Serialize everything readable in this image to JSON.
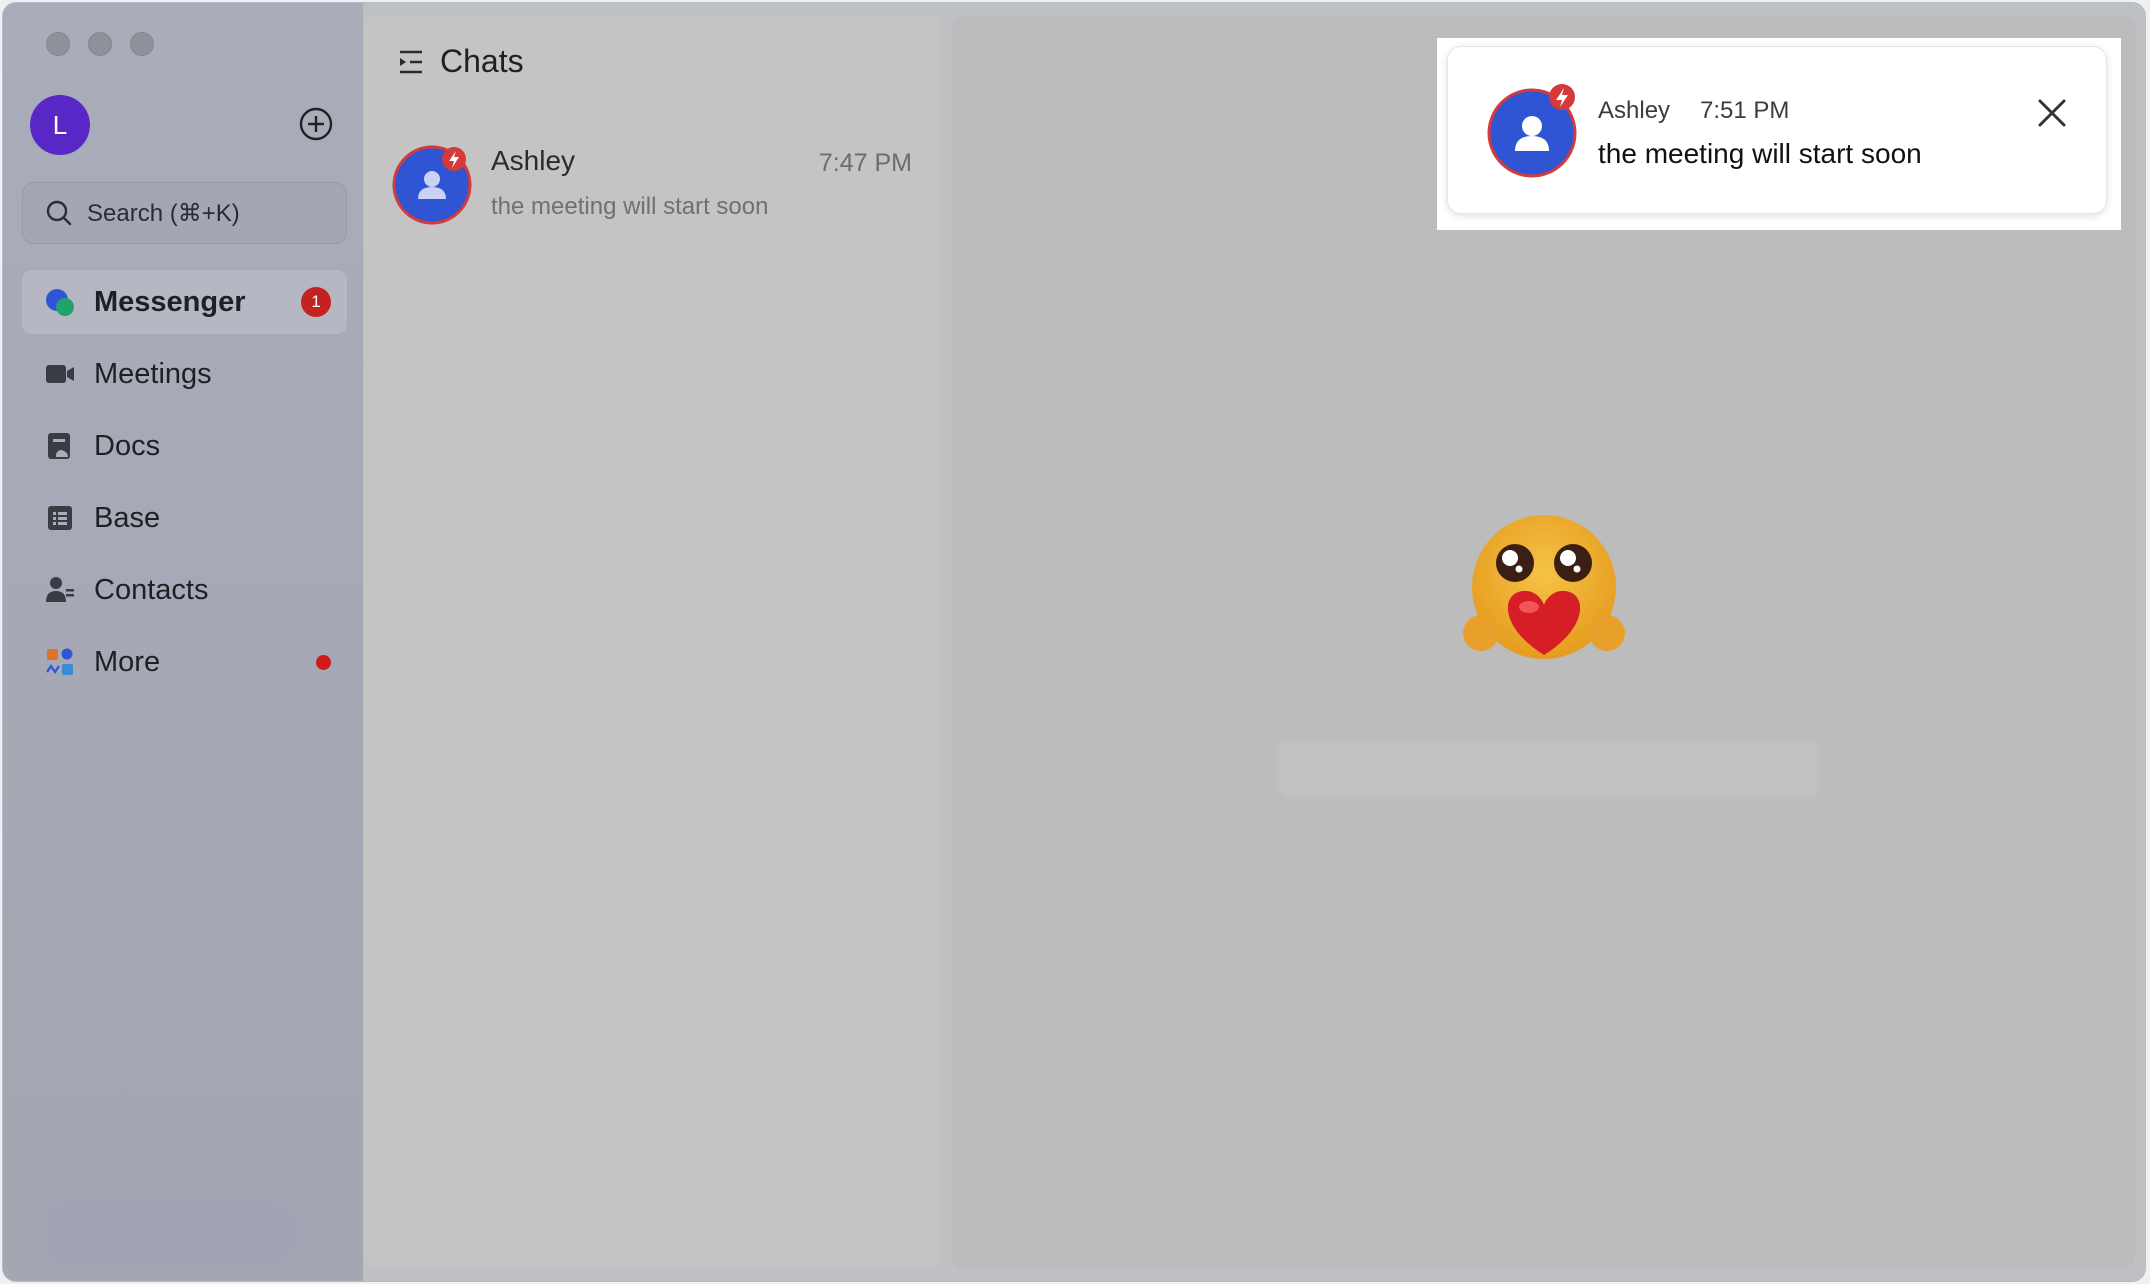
{
  "sidebar": {
    "profile_initial": "L",
    "search_placeholder": "Search (⌘+K)",
    "nav": [
      {
        "label": "Messenger",
        "icon": "messenger-icon",
        "badge": "1",
        "active": true
      },
      {
        "label": "Meetings",
        "icon": "video-camera-icon"
      },
      {
        "label": "Docs",
        "icon": "docs-icon"
      },
      {
        "label": "Base",
        "icon": "base-icon"
      },
      {
        "label": "Contacts",
        "icon": "contacts-icon"
      },
      {
        "label": "More",
        "icon": "apps-grid-icon",
        "dot": true
      }
    ]
  },
  "chatlist": {
    "title": "Chats",
    "items": [
      {
        "name": "Ashley",
        "time": "7:47 PM",
        "preview": "the meeting will start soon"
      }
    ]
  },
  "notification": {
    "name": "Ashley",
    "time": "7:51 PM",
    "message": "the meeting will start soon"
  },
  "colors": {
    "badge": "#c42121",
    "avatar_blue": "#2f55d4",
    "profile_purple": "#5a27c7"
  }
}
